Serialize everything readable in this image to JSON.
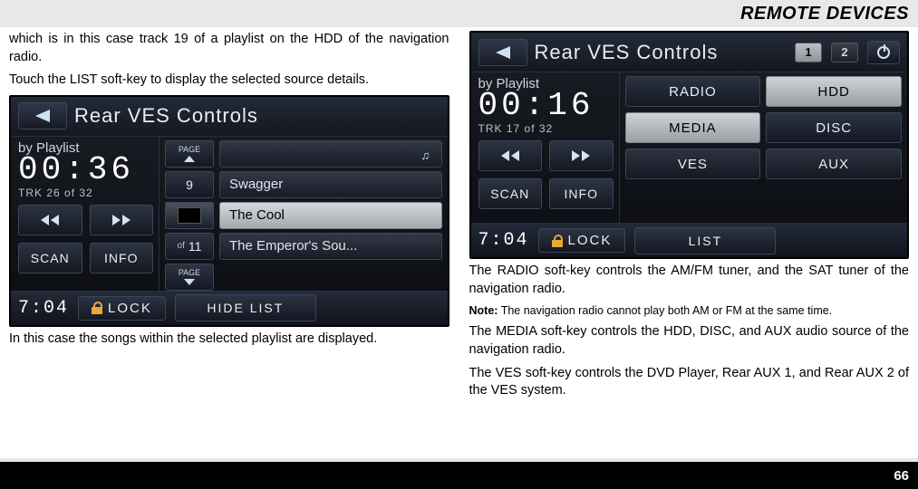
{
  "header": {
    "title": "REMOTE DEVICES"
  },
  "left": {
    "p1": "which is in this case track 19 of a playlist on the HDD of the navigation radio.",
    "p2": "Touch the LIST soft-key to display the selected source details.",
    "p3": "In this case the songs within the selected playlist are displayed.",
    "screen": {
      "title": "Rear VES Controls",
      "byline": "by Playlist",
      "time": "00:36",
      "trk": "TRK 26 of 32",
      "scan": "SCAN",
      "info": "INFO",
      "page_label": "PAGE",
      "num_top": "9",
      "of": "of",
      "num_bot": "11",
      "item1": "Swagger",
      "item2": "The Cool",
      "item3": "The Emperor's Sou...",
      "clock": "7:04",
      "lock": "LOCK",
      "hide": "HIDE LIST"
    }
  },
  "right": {
    "screen": {
      "title": "Rear VES Controls",
      "badge1": "1",
      "badge2": "2",
      "byline": "by Playlist",
      "time": "00:16",
      "trk": "TRK 17 of 32",
      "scan": "SCAN",
      "info": "INFO",
      "radio": "RADIO",
      "hdd": "HDD",
      "media": "MEDIA",
      "disc": "DISC",
      "ves": "VES",
      "aux": "AUX",
      "clock": "7:04",
      "lock": "LOCK",
      "list": "LIST"
    },
    "p1": "The RADIO soft-key controls the AM/FM tuner, and the SAT tuner of the navigation radio.",
    "note_label": "Note:",
    "note_text": " The navigation radio cannot play both AM or FM at the same time.",
    "p2": "The MEDIA soft-key controls the HDD, DISC, and AUX audio source of the navigation radio.",
    "p3": "The VES soft-key controls the DVD Player, Rear AUX 1, and Rear AUX 2 of the VES system."
  },
  "footer": {
    "page": "66"
  }
}
